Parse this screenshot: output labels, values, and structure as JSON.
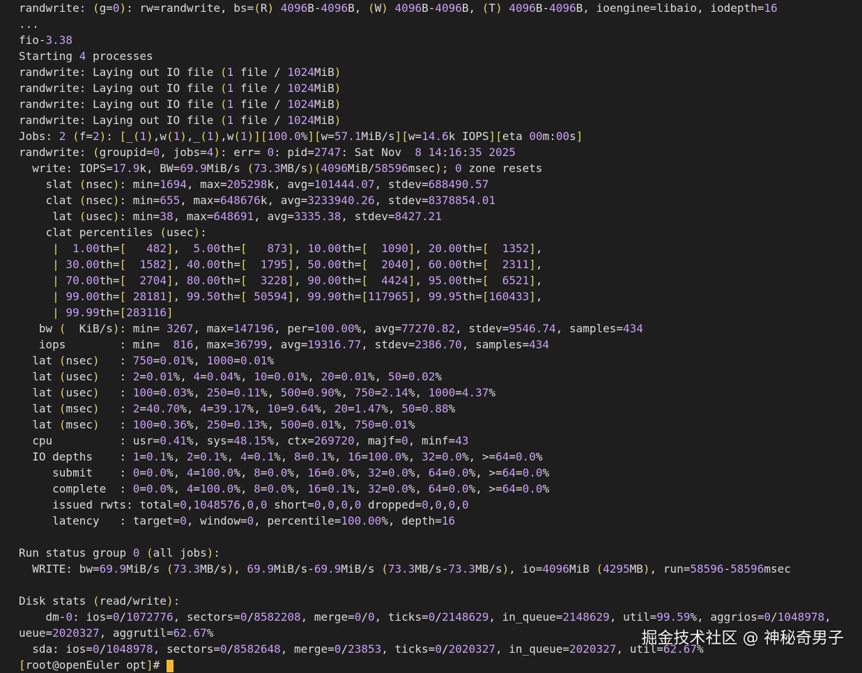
{
  "lines": [
    "randwrite: (g=0): rw=randwrite, bs=(R) 4096B-4096B, (W) 4096B-4096B, (T) 4096B-4096B, ioengine=libaio, iodepth=16",
    "...",
    "fio-3.38",
    "Starting 4 processes",
    "randwrite: Laying out IO file (1 file / 1024MiB)",
    "randwrite: Laying out IO file (1 file / 1024MiB)",
    "randwrite: Laying out IO file (1 file / 1024MiB)",
    "randwrite: Laying out IO file (1 file / 1024MiB)",
    "Jobs: 2 (f=2): [_(1),w(1),_(1),w(1)][100.0%][w=57.1MiB/s][w=14.6k IOPS][eta 00m:00s]",
    "randwrite: (groupid=0, jobs=4): err= 0: pid=2747: Sat Nov  8 14:16:35 2025",
    "  write: IOPS=17.9k, BW=69.9MiB/s (73.3MB/s)(4096MiB/58596msec); 0 zone resets",
    "    slat (nsec): min=1694, max=205298k, avg=101444.07, stdev=688490.57",
    "    clat (nsec): min=655, max=648676k, avg=3233940.26, stdev=8378854.01",
    "     lat (usec): min=38, max=648691, avg=3335.38, stdev=8427.21",
    "    clat percentiles (usec):",
    "     |  1.00th=[   482],  5.00th=[   873], 10.00th=[  1090], 20.00th=[  1352],",
    "     | 30.00th=[  1582], 40.00th=[  1795], 50.00th=[  2040], 60.00th=[  2311],",
    "     | 70.00th=[  2704], 80.00th=[  3228], 90.00th=[  4424], 95.00th=[  6521],",
    "     | 99.00th=[ 28181], 99.50th=[ 50594], 99.90th=[117965], 99.95th=[160433],",
    "     | 99.99th=[283116]",
    "   bw (  KiB/s): min= 3267, max=147196, per=100.00%, avg=77270.82, stdev=9546.74, samples=434",
    "   iops        : min=  816, max=36799, avg=19316.77, stdev=2386.70, samples=434",
    "  lat (nsec)   : 750=0.01%, 1000=0.01%",
    "  lat (usec)   : 2=0.01%, 4=0.04%, 10=0.01%, 20=0.01%, 50=0.02%",
    "  lat (usec)   : 100=0.03%, 250=0.11%, 500=0.90%, 750=2.14%, 1000=4.37%",
    "  lat (msec)   : 2=40.70%, 4=39.17%, 10=9.64%, 20=1.47%, 50=0.88%",
    "  lat (msec)   : 100=0.36%, 250=0.13%, 500=0.01%, 750=0.01%",
    "  cpu          : usr=0.41%, sys=48.15%, ctx=269720, majf=0, minf=43",
    "  IO depths    : 1=0.1%, 2=0.1%, 4=0.1%, 8=0.1%, 16=100.0%, 32=0.0%, >=64=0.0%",
    "     submit    : 0=0.0%, 4=100.0%, 8=0.0%, 16=0.0%, 32=0.0%, 64=0.0%, >=64=0.0%",
    "     complete  : 0=0.0%, 4=100.0%, 8=0.0%, 16=0.1%, 32=0.0%, 64=0.0%, >=64=0.0%",
    "     issued rwts: total=0,1048576,0,0 short=0,0,0,0 dropped=0,0,0,0",
    "     latency   : target=0, window=0, percentile=100.00%, depth=16",
    "",
    "Run status group 0 (all jobs):",
    "  WRITE: bw=69.9MiB/s (73.3MB/s), 69.9MiB/s-69.9MiB/s (73.3MB/s-73.3MB/s), io=4096MiB (4295MB), run=58596-58596msec",
    "",
    "Disk stats (read/write):",
    "    dm-0: ios=0/1072776, sectors=0/8582208, merge=0/0, ticks=0/2148629, in_queue=2148629, util=99.59%, aggrios=0/1048978,",
    "ueue=2020327, aggrutil=62.67%",
    "  sda: ios=0/1048978, sectors=0/8582648, merge=0/23853, ticks=0/2020327, in_queue=2020327, util=62.67%",
    "[root@openEuler opt]# "
  ],
  "watermark": "掘金技术社区 @ 神秘奇男子",
  "colors": {
    "background": "#1e1e1e",
    "text": "#dcdcdc",
    "number": "#c9a0f5",
    "punctuation": "#e7d26b",
    "green": "#a9de83",
    "cursor": "#f7b733"
  }
}
